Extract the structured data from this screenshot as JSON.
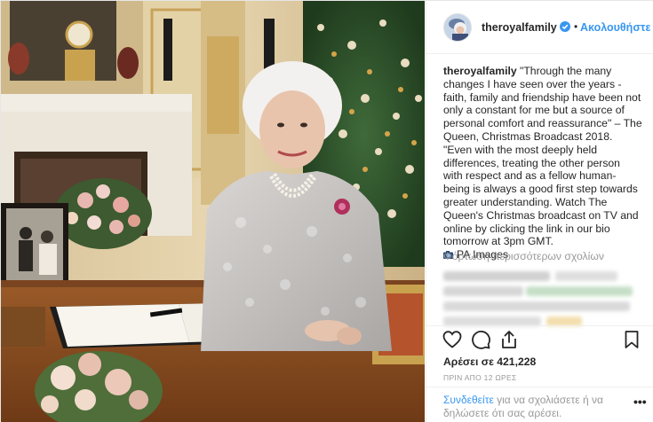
{
  "post": {
    "username": "theroyalfamily",
    "follow_dot": "•",
    "follow_label": "Ακολουθήστε",
    "caption_username": "theroyalfamily",
    "caption_lines": [
      "\"Through the many changes I have seen over the years - faith, family and friendship have been not only a constant for me but a source of personal comfort and reassurance\" – The Queen, Christmas Broadcast 2018.",
      "\"Even with the most deeply held differences, treating the other person with respect and as a fellow human-being is always a good first step towards greater understanding. Watch The Queen's Christmas broadcast on TV and online by clicking the link in our bio tomorrow at 3pm GMT."
    ],
    "credit": "PA Images",
    "load_more": "Φόρτωση περισσότερων σχολίων",
    "likes": "Αρέσει σε 421,228",
    "time_ago": "ΠΡΙΝ ΑΠΟ 12 ΩΡΕΣ",
    "login_link": "Συνδεθείτε",
    "login_rest": " για να σχολιάσετε ή να δηλώσετε ότι σας αρέσει.",
    "more_options": "•••"
  },
  "icons": {
    "verified": "verified-badge-icon",
    "like": "heart-icon",
    "comment": "comment-bubble-icon",
    "share": "share-icon",
    "save": "bookmark-icon",
    "camera": "camera-icon"
  },
  "colors": {
    "link_blue": "#3897f0",
    "text": "#262626",
    "muted": "#999999"
  }
}
